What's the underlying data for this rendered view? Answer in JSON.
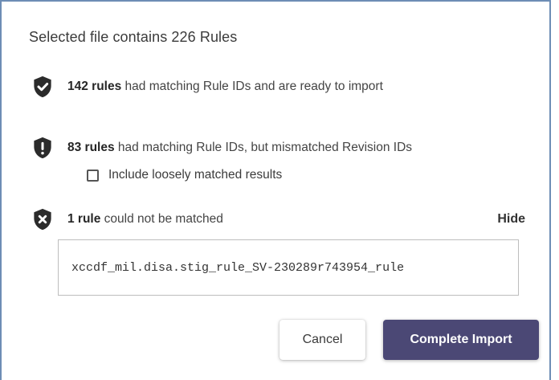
{
  "summary": {
    "prefix": "Selected file contains ",
    "count": "226",
    "suffix": " Rules"
  },
  "matched": {
    "icon": "shield-check-icon",
    "count_label": "142 rules",
    "text": " had matching Rule IDs and are ready to import"
  },
  "mismatched": {
    "icon": "shield-exclamation-icon",
    "count_label": "83 rules",
    "text": " had matching Rule IDs, but mismatched Revision IDs",
    "checkbox_label": "Include loosely matched results",
    "checkbox_checked": false
  },
  "unmatched": {
    "icon": "shield-x-icon",
    "count_label": "1 rule",
    "text": " could not be matched",
    "toggle_label": "Hide",
    "rule_id": "xccdf_mil.disa.stig_rule_SV-230289r743954_rule"
  },
  "buttons": {
    "cancel": "Cancel",
    "complete": "Complete Import"
  },
  "colors": {
    "primary_button": "#4b4875",
    "icon_fill": "#2b2b2b",
    "dialog_border": "#6d8db5"
  }
}
